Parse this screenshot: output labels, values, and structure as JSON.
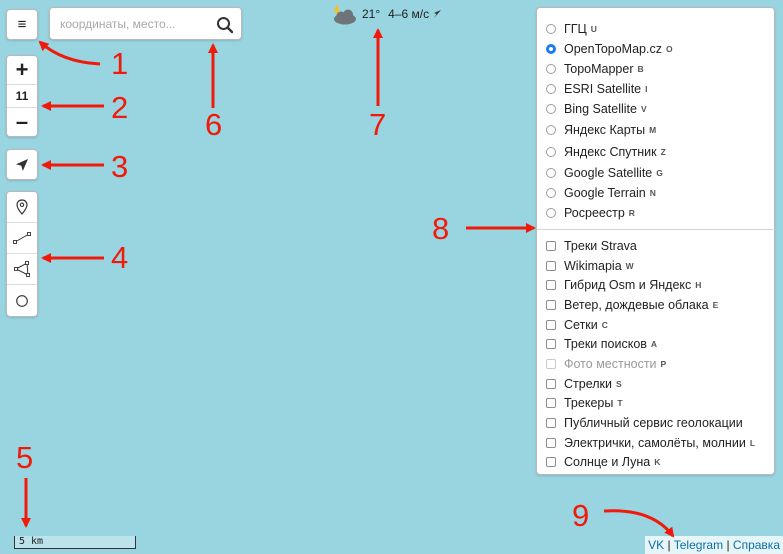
{
  "search": {
    "placeholder": "координаты, место..."
  },
  "menu": {
    "label": "≡"
  },
  "zoom": {
    "in_label": "+",
    "level": "11",
    "out_label": "–"
  },
  "weather": {
    "temperature": "21°",
    "wind": "4–6 м/с",
    "icon": "partly-cloudy-night-icon"
  },
  "layers": {
    "base": [
      {
        "label": "ГГЦ",
        "hotkey": "U",
        "selected": false
      },
      {
        "label": "OpenTopoMap.cz",
        "hotkey": "O",
        "selected": true
      },
      {
        "label": "TopoMapper",
        "hotkey": "B",
        "selected": false
      },
      {
        "label": "ESRI Satellite",
        "hotkey": "I",
        "selected": false
      },
      {
        "label": "Bing Satellite",
        "hotkey": "V",
        "selected": false
      },
      {
        "label": "Яндекс Карты",
        "hotkey": "M",
        "selected": false
      },
      {
        "label": "Яндекс Спутник",
        "hotkey": "Z",
        "selected": false
      },
      {
        "label": "Google Satellite",
        "hotkey": "G",
        "selected": false
      },
      {
        "label": "Google Terrain",
        "hotkey": "N",
        "selected": false
      },
      {
        "label": "Росреестр",
        "hotkey": "R",
        "selected": false
      }
    ],
    "overlays": [
      {
        "label": "Треки Strava",
        "hotkey": ""
      },
      {
        "label": "Wikimapia",
        "hotkey": "W"
      },
      {
        "label": "Гибрид Osm и Яндекс",
        "hotkey": "H"
      },
      {
        "label": "Ветер, дождевые облака",
        "hotkey": "E"
      },
      {
        "label": "Сетки",
        "hotkey": "C"
      },
      {
        "label": "Треки поисков",
        "hotkey": "A"
      },
      {
        "label": "Фото местности",
        "hotkey": "P",
        "disabled": true
      },
      {
        "label": "Стрелки",
        "hotkey": "S"
      },
      {
        "label": "Трекеры",
        "hotkey": "T"
      },
      {
        "label": "Публичный сервис геолокации",
        "hotkey": ""
      },
      {
        "label": "Электрички, самолёты, молнии",
        "hotkey": "L"
      },
      {
        "label": "Солнце и Луна",
        "hotkey": "K"
      }
    ]
  },
  "scale": {
    "label": "5 km"
  },
  "footer": {
    "vk": "VK",
    "telegram": "Telegram",
    "help": "Справка",
    "separator": "|"
  },
  "annotations": [
    "1",
    "2",
    "3",
    "4",
    "5",
    "6",
    "7",
    "8",
    "9"
  ],
  "colors": {
    "map_background": "#99d5e1",
    "annotation_red": "#f11a0a",
    "radio_accent": "#1a7cf0"
  }
}
